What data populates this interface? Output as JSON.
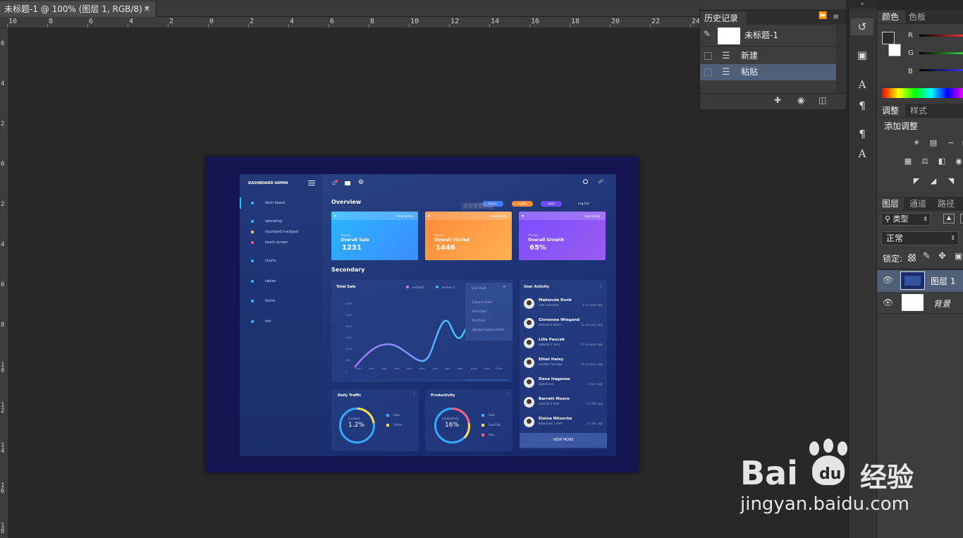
{
  "document_tab": {
    "title": "未标题-1 @ 100% (图层 1, RGB/8) *",
    "close": "×"
  },
  "ruler_h": [
    "10",
    "8",
    "6",
    "4",
    "2",
    "0",
    "2",
    "4",
    "6",
    "8",
    "10",
    "12",
    "14",
    "16",
    "18",
    "20",
    "22",
    "24"
  ],
  "ruler_v": [
    "6",
    "4",
    "2",
    "0",
    "2",
    "4",
    "6",
    "8",
    "1 0",
    "1 2",
    "1 4",
    "1 6",
    "1 8"
  ],
  "dashboard": {
    "brand": "DASHBOARD ADMIN",
    "sidebar": [
      {
        "label": "dash board",
        "color": "#33bbff"
      },
      {
        "label": "operating",
        "color": "#33bbff"
      },
      {
        "label": "touchpad trackpad",
        "color": "#ffd84d"
      },
      {
        "label": "touch screen",
        "color": "#ff5a7a"
      },
      {
        "label": "charts",
        "color": "#33bbff"
      },
      {
        "label": "tables",
        "color": "#33bbff"
      },
      {
        "label": "forms",
        "color": "#33bbff"
      },
      {
        "label": "tier",
        "color": "#33bbff"
      }
    ],
    "overview_title": "Overview",
    "pills": [
      "today",
      "month",
      "year"
    ],
    "logout": "Log Out",
    "watermark": "点击查看原图",
    "cards": [
      {
        "small": "#today",
        "title": "Overall Sale",
        "value": "1231",
        "link": "View Detail",
        "color_a": "#29b6ff",
        "color_b": "#3d8cff"
      },
      {
        "small": "#today",
        "title": "Overall Visited",
        "value": "1446",
        "link": "View Detail",
        "color_a": "#ff8a35",
        "color_b": "#ffb056"
      },
      {
        "small": "#today",
        "title": "Overall Growth",
        "value": "65%",
        "link": "View Detail",
        "color_a": "#7a4dff",
        "color_b": "#9b5cf0"
      }
    ],
    "secondary_title": "Secondary",
    "total_sale": {
      "title": "Total Sale",
      "legend": [
        "section1",
        "section 2"
      ],
      "dropdown": "Line Chart",
      "options": [
        "Column Chart",
        "Line Chart",
        "Pie Chart",
        "Stacked Column Chart"
      ],
      "yticks": [
        "5000",
        "2500",
        "2000",
        "1500",
        "1000",
        "500",
        "0"
      ],
      "xticks": [
        "1km",
        "2km",
        "3km",
        "4km",
        "5km",
        "6km",
        "7km",
        "8km",
        "9km",
        "10km",
        "11km",
        "12km"
      ]
    },
    "daily_traffic": {
      "title": "Daily Traffic",
      "inner_label": "increase",
      "value": "1.2%",
      "legend": [
        "User",
        "Visitor"
      ],
      "colors": [
        "#33aaff",
        "#ffd84d"
      ]
    },
    "productivity": {
      "title": "Productivity",
      "inner_label": "productivity",
      "value": "16%",
      "legend": [
        "Safe",
        "Low Risk",
        "Risk"
      ],
      "colors": [
        "#33aaff",
        "#ffd84d",
        "#ff5a7a"
      ]
    },
    "user_activity": {
      "title": "User Activity",
      "users": [
        {
          "name": "Makenzie Roob",
          "desc": "new comment",
          "time": "4 minutes ago"
        },
        {
          "name": "Giovanna Wiegand",
          "desc": "ordered 2 items",
          "time": "15 minutes ago"
        },
        {
          "name": "Lilla Paucek",
          "desc": "ordered 1 item",
          "time": "35 minutes ago"
        },
        {
          "name": "Ethel Haley",
          "desc": "sended message",
          "time": "43 minutes ago"
        },
        {
          "name": "Dena Hagenes",
          "desc": "signed out",
          "time": "1 hour ago"
        },
        {
          "name": "Barrett Moore",
          "desc": "ordered 2 item",
          "time": "1st 9th ago"
        },
        {
          "name": "Elaina Nitzsche",
          "desc": "bookmark 1 item",
          "time": "1st 4th ago"
        }
      ],
      "view_more": "VIEW MORE"
    }
  },
  "history_panel": {
    "tab": "历史记录",
    "snapshot": "未标题-1",
    "items": [
      "新建",
      "粘贴"
    ]
  },
  "color_panel": {
    "tabs": [
      "颜色",
      "色板"
    ],
    "channels": [
      "R",
      "G",
      "B"
    ]
  },
  "adjust_panel": {
    "tabs": [
      "调整",
      "样式"
    ],
    "heading": "添加调整"
  },
  "layers_panel": {
    "tabs": [
      "图层",
      "通道",
      "路径"
    ],
    "filter": "类型",
    "blend": "正常",
    "lock_label": "锁定:",
    "layers": [
      "图层 1",
      "背景"
    ]
  },
  "baidu": {
    "brand": "Bai",
    "jy": "经验",
    "url": "jingyan.baidu.com"
  }
}
